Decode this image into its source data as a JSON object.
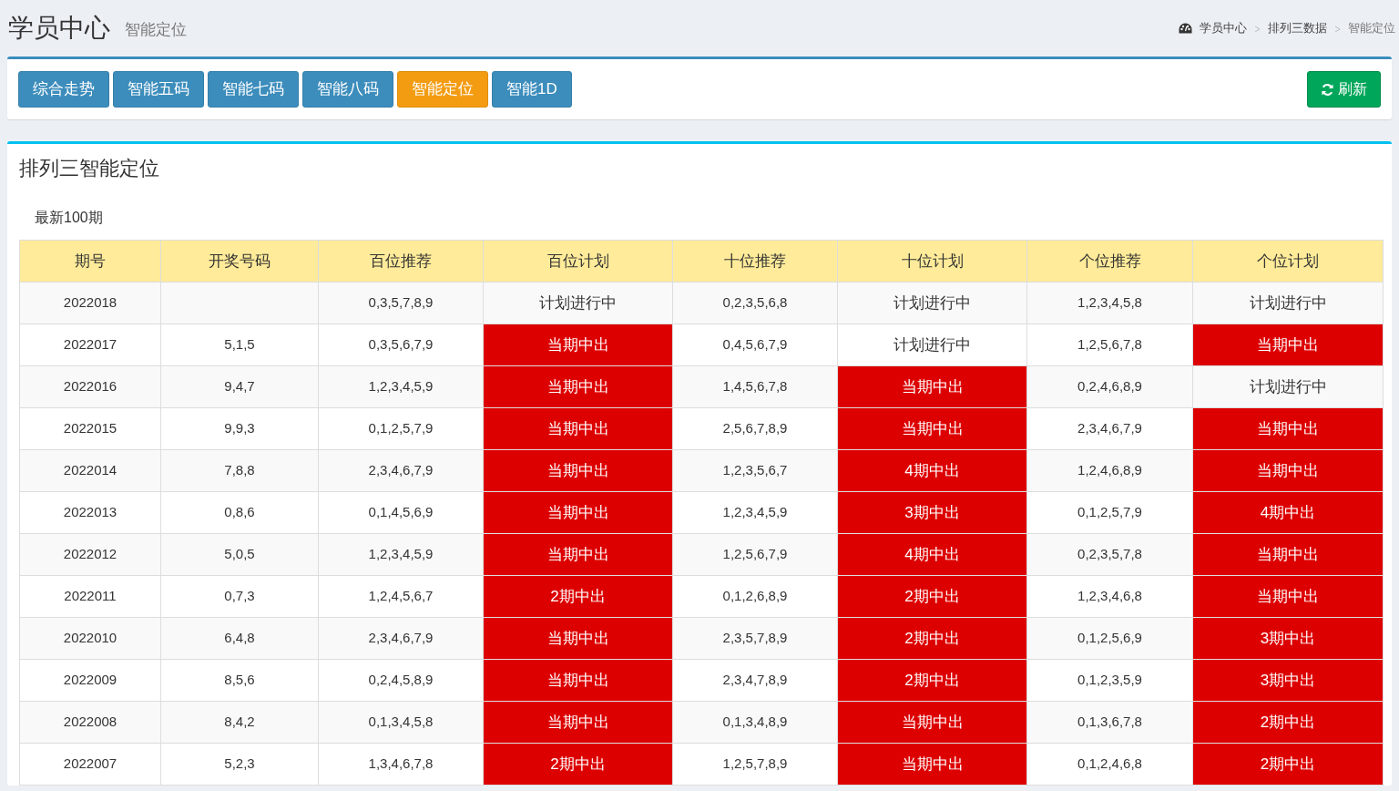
{
  "header": {
    "title": "学员中心",
    "subtitle": "智能定位"
  },
  "breadcrumb": [
    {
      "label": "学员中心",
      "kind": "home"
    },
    {
      "label": "排列三数据",
      "kind": "link"
    },
    {
      "label": "智能定位",
      "kind": "current"
    }
  ],
  "nav_buttons": [
    {
      "label": "综合走势",
      "selected": false
    },
    {
      "label": "智能五码",
      "selected": false
    },
    {
      "label": "智能七码",
      "selected": false
    },
    {
      "label": "智能八码",
      "selected": false
    },
    {
      "label": "智能定位",
      "selected": true
    },
    {
      "label": "智能1D",
      "selected": false
    }
  ],
  "refresh_button": {
    "label": "刷新"
  },
  "panel": {
    "title": "排列三智能定位",
    "subtitle": "最新100期"
  },
  "table": {
    "columns": [
      "期号",
      "开奖号码",
      "百位推荐",
      "百位计划",
      "十位推荐",
      "十位计划",
      "个位推荐",
      "个位计划"
    ],
    "rows": [
      {
        "issue": "2022018",
        "draw": "",
        "hundreds_pick": "0,3,5,7,8,9",
        "hundreds_plan": {
          "text": "计划进行中",
          "hit": false
        },
        "tens_pick": "0,2,3,5,6,8",
        "tens_plan": {
          "text": "计划进行中",
          "hit": false
        },
        "units_pick": "1,2,3,4,5,8",
        "units_plan": {
          "text": "计划进行中",
          "hit": false
        }
      },
      {
        "issue": "2022017",
        "draw": "5,1,5",
        "hundreds_pick": "0,3,5,6,7,9",
        "hundreds_plan": {
          "text": "当期中出",
          "hit": true
        },
        "tens_pick": "0,4,5,6,7,9",
        "tens_plan": {
          "text": "计划进行中",
          "hit": false
        },
        "units_pick": "1,2,5,6,7,8",
        "units_plan": {
          "text": "当期中出",
          "hit": true
        }
      },
      {
        "issue": "2022016",
        "draw": "9,4,7",
        "hundreds_pick": "1,2,3,4,5,9",
        "hundreds_plan": {
          "text": "当期中出",
          "hit": true
        },
        "tens_pick": "1,4,5,6,7,8",
        "tens_plan": {
          "text": "当期中出",
          "hit": true
        },
        "units_pick": "0,2,4,6,8,9",
        "units_plan": {
          "text": "计划进行中",
          "hit": false
        }
      },
      {
        "issue": "2022015",
        "draw": "9,9,3",
        "hundreds_pick": "0,1,2,5,7,9",
        "hundreds_plan": {
          "text": "当期中出",
          "hit": true
        },
        "tens_pick": "2,5,6,7,8,9",
        "tens_plan": {
          "text": "当期中出",
          "hit": true
        },
        "units_pick": "2,3,4,6,7,9",
        "units_plan": {
          "text": "当期中出",
          "hit": true
        }
      },
      {
        "issue": "2022014",
        "draw": "7,8,8",
        "hundreds_pick": "2,3,4,6,7,9",
        "hundreds_plan": {
          "text": "当期中出",
          "hit": true
        },
        "tens_pick": "1,2,3,5,6,7",
        "tens_plan": {
          "text": "4期中出",
          "hit": true
        },
        "units_pick": "1,2,4,6,8,9",
        "units_plan": {
          "text": "当期中出",
          "hit": true
        }
      },
      {
        "issue": "2022013",
        "draw": "0,8,6",
        "hundreds_pick": "0,1,4,5,6,9",
        "hundreds_plan": {
          "text": "当期中出",
          "hit": true
        },
        "tens_pick": "1,2,3,4,5,9",
        "tens_plan": {
          "text": "3期中出",
          "hit": true
        },
        "units_pick": "0,1,2,5,7,9",
        "units_plan": {
          "text": "4期中出",
          "hit": true
        }
      },
      {
        "issue": "2022012",
        "draw": "5,0,5",
        "hundreds_pick": "1,2,3,4,5,9",
        "hundreds_plan": {
          "text": "当期中出",
          "hit": true
        },
        "tens_pick": "1,2,5,6,7,9",
        "tens_plan": {
          "text": "4期中出",
          "hit": true
        },
        "units_pick": "0,2,3,5,7,8",
        "units_plan": {
          "text": "当期中出",
          "hit": true
        }
      },
      {
        "issue": "2022011",
        "draw": "0,7,3",
        "hundreds_pick": "1,2,4,5,6,7",
        "hundreds_plan": {
          "text": "2期中出",
          "hit": true
        },
        "tens_pick": "0,1,2,6,8,9",
        "tens_plan": {
          "text": "2期中出",
          "hit": true
        },
        "units_pick": "1,2,3,4,6,8",
        "units_plan": {
          "text": "当期中出",
          "hit": true
        }
      },
      {
        "issue": "2022010",
        "draw": "6,4,8",
        "hundreds_pick": "2,3,4,6,7,9",
        "hundreds_plan": {
          "text": "当期中出",
          "hit": true
        },
        "tens_pick": "2,3,5,7,8,9",
        "tens_plan": {
          "text": "2期中出",
          "hit": true
        },
        "units_pick": "0,1,2,5,6,9",
        "units_plan": {
          "text": "3期中出",
          "hit": true
        }
      },
      {
        "issue": "2022009",
        "draw": "8,5,6",
        "hundreds_pick": "0,2,4,5,8,9",
        "hundreds_plan": {
          "text": "当期中出",
          "hit": true
        },
        "tens_pick": "2,3,4,7,8,9",
        "tens_plan": {
          "text": "2期中出",
          "hit": true
        },
        "units_pick": "0,1,2,3,5,9",
        "units_plan": {
          "text": "3期中出",
          "hit": true
        }
      },
      {
        "issue": "2022008",
        "draw": "8,4,2",
        "hundreds_pick": "0,1,3,4,5,8",
        "hundreds_plan": {
          "text": "当期中出",
          "hit": true
        },
        "tens_pick": "0,1,3,4,8,9",
        "tens_plan": {
          "text": "当期中出",
          "hit": true
        },
        "units_pick": "0,1,3,6,7,8",
        "units_plan": {
          "text": "2期中出",
          "hit": true
        }
      },
      {
        "issue": "2022007",
        "draw": "5,2,3",
        "hundreds_pick": "1,3,4,6,7,8",
        "hundreds_plan": {
          "text": "2期中出",
          "hit": true
        },
        "tens_pick": "1,2,5,7,8,9",
        "tens_plan": {
          "text": "当期中出",
          "hit": true
        },
        "units_pick": "0,1,2,4,6,8",
        "units_plan": {
          "text": "2期中出",
          "hit": true
        }
      }
    ]
  }
}
